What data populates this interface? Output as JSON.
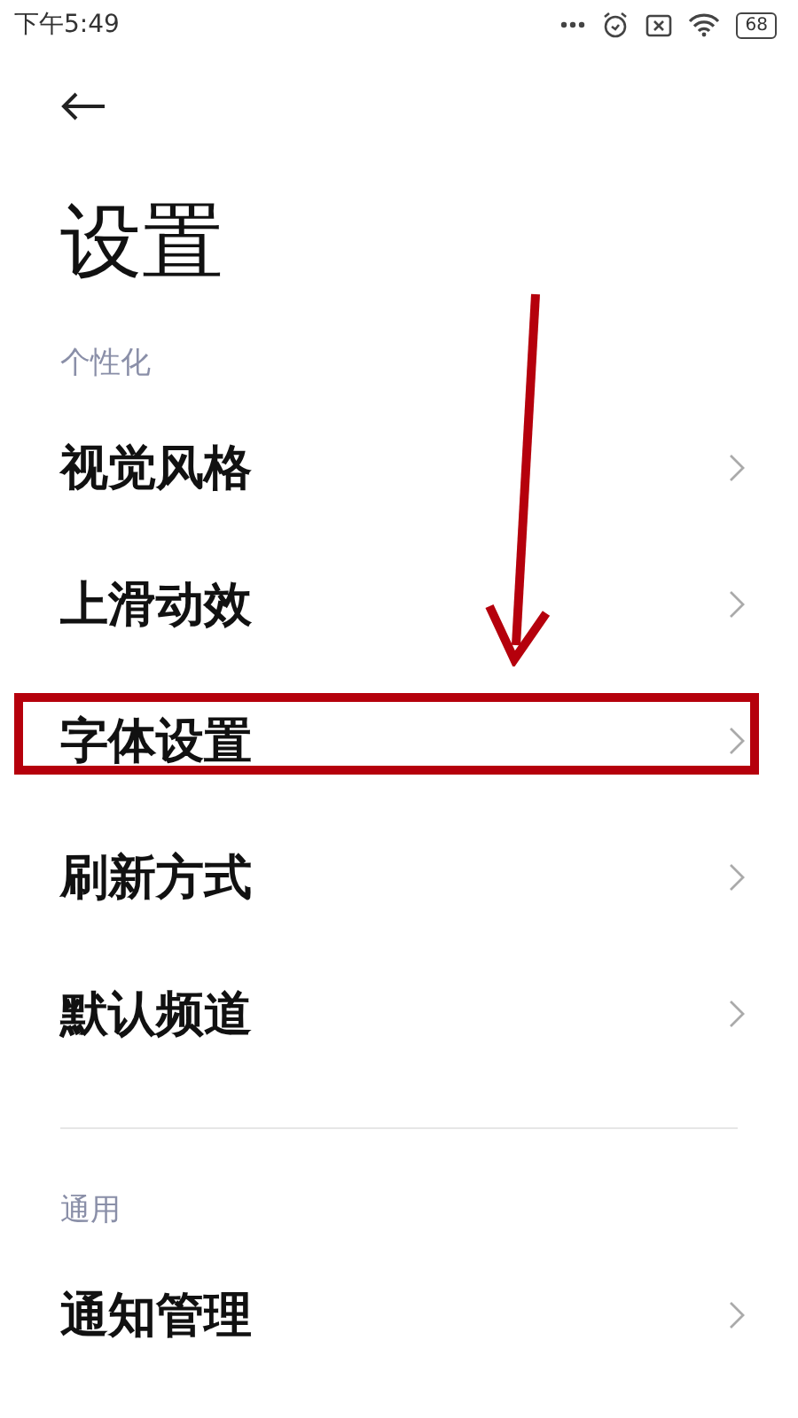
{
  "status_bar": {
    "time": "下午5:49",
    "battery": "68"
  },
  "title": "设置",
  "sections": [
    {
      "label": "个性化",
      "items": [
        {
          "label": "视觉风格",
          "highlighted": false
        },
        {
          "label": "上滑动效",
          "highlighted": false
        },
        {
          "label": "字体设置",
          "highlighted": true
        },
        {
          "label": "刷新方式",
          "highlighted": false
        },
        {
          "label": "默认频道",
          "highlighted": false
        }
      ]
    },
    {
      "label": "通用",
      "items": [
        {
          "label": "通知管理",
          "highlighted": false
        }
      ]
    }
  ]
}
